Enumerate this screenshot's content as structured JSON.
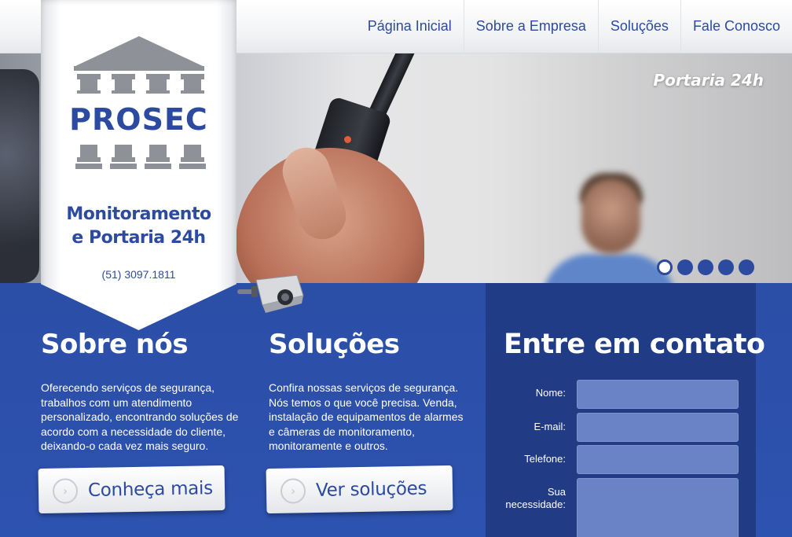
{
  "nav": {
    "items": [
      {
        "label": "Página Inicial"
      },
      {
        "label": "Sobre a Empresa"
      },
      {
        "label": "Soluções"
      },
      {
        "label": "Fale Conosco"
      }
    ]
  },
  "hero": {
    "caption": "Portaria 24h",
    "slides_total": 5,
    "active_slide": 1
  },
  "brand": {
    "name": "PROSEC",
    "tagline_line1": "Monitoramento",
    "tagline_line2": "e Portaria 24h",
    "phone": "(51) 3097.1811"
  },
  "about": {
    "title": "Sobre nós",
    "text": "Oferecendo serviços de segurança, trabalhos com um atendimento personalizado, encontrando soluções de acordo com a necessidade do cliente, deixando-o cada vez mais seguro.",
    "button_label": "Conheça mais"
  },
  "solutions": {
    "title": "Soluções",
    "text": "Confira nossas serviços de segurança. Nós temos o que você precisa. Venda, instalação de equipamentos de alarmes e câmeras de monitoramento, monitoramente e outros.",
    "button_label": "Ver soluções"
  },
  "contact": {
    "title": "Entre em contato",
    "fields": [
      {
        "label": "Nome:",
        "value": ""
      },
      {
        "label": "E-mail:",
        "value": ""
      },
      {
        "label": "Telefone:",
        "value": ""
      },
      {
        "label_line1": "Sua",
        "label_line2": "necessidade:",
        "value": ""
      }
    ]
  },
  "colors": {
    "brand_blue": "#2c4aa0",
    "content_bg": "#2b4ea6",
    "contact_bg": "#213c86",
    "field_bg": "#6a82c6"
  },
  "icons": {
    "logo": "temple-columns-icon",
    "button": "chevron-right-circle-icon",
    "decor": "security-camera-icon"
  }
}
